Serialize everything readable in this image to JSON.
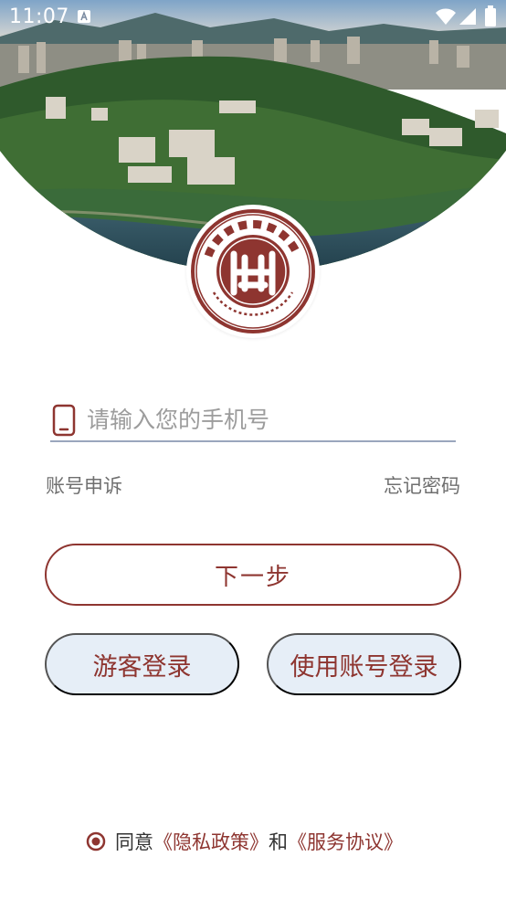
{
  "status_bar": {
    "time": "11:07"
  },
  "login": {
    "phone_placeholder": "请输入您的手机号",
    "appeal_label": "账号申诉",
    "forgot_label": "忘记密码",
    "next_label": "下一步",
    "guest_label": "游客登录",
    "account_label": "使用账号登录"
  },
  "agreement": {
    "prefix": "同意",
    "privacy_link": "《隐私政策》",
    "conjunction": "和",
    "service_link": "《服务协议》"
  },
  "logo": {
    "seal_text_cn": "湖北理工学院",
    "seal_text_en": "HUBEI POLYTECHNIC UNIVERSITY"
  },
  "colors": {
    "brand": "#8e3530",
    "pill_bg": "#e6eef7",
    "underline": "#9aa6bd",
    "muted_text": "#6f6f6f"
  },
  "icons": [
    "notification-icon",
    "wifi-icon",
    "signal-icon",
    "battery-icon",
    "phone-icon",
    "radio-checked-icon"
  ]
}
